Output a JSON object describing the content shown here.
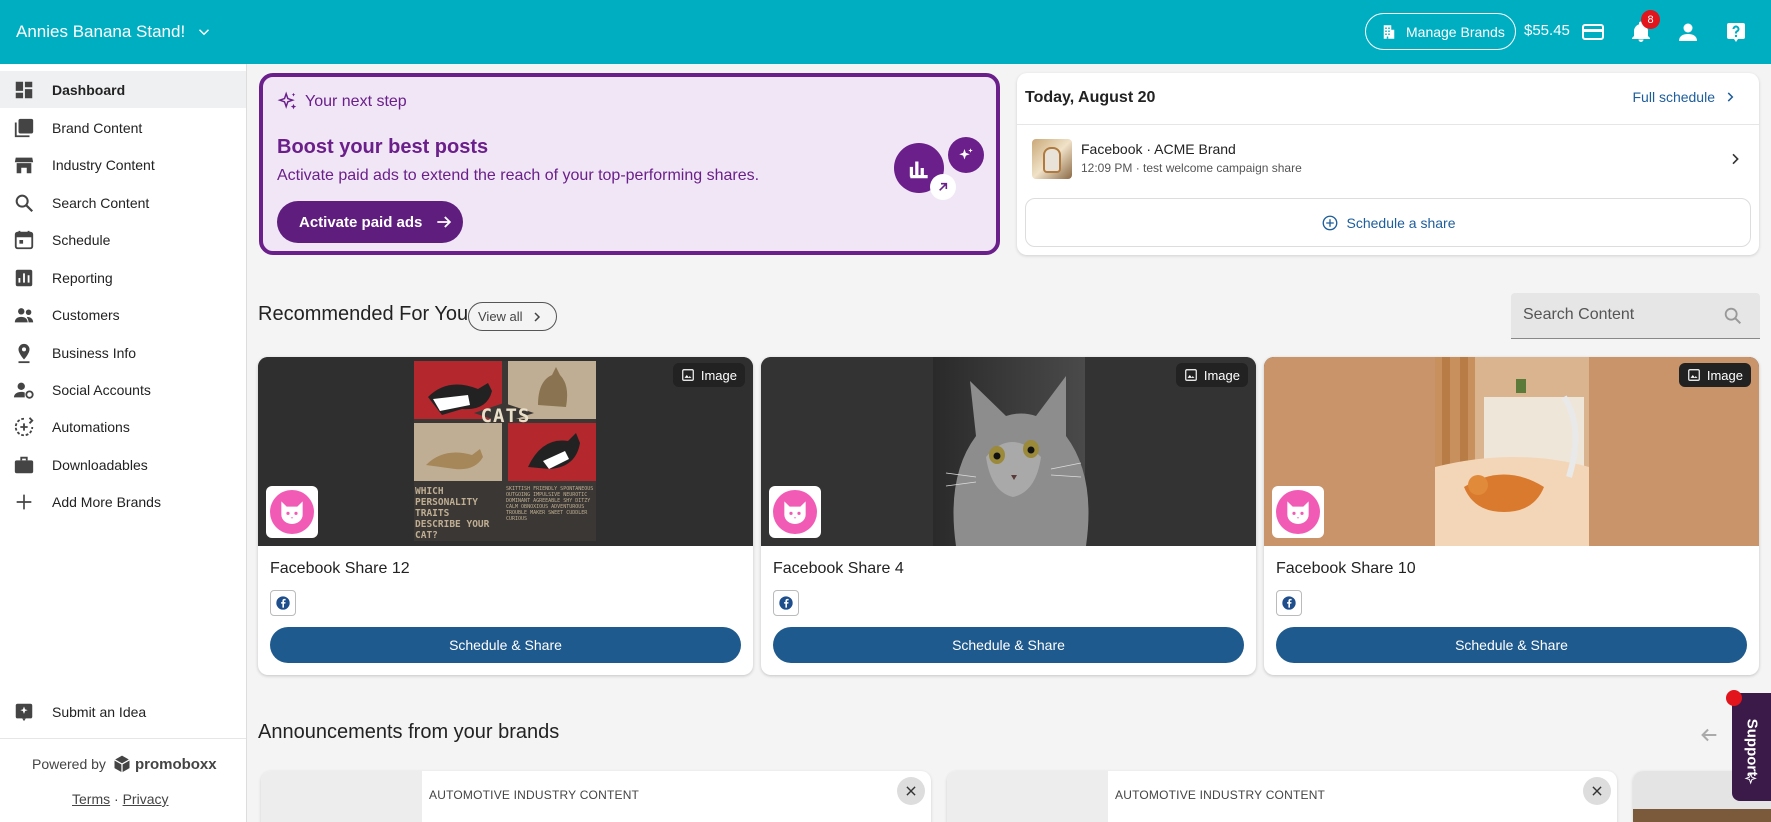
{
  "colors": {
    "topbar": "#00aec2",
    "accent_purple": "#6a1f8a",
    "primary_button": "#1f5a8e",
    "link_blue": "#1d5d9b",
    "badge_red": "#e2141c"
  },
  "header": {
    "brand_name": "Annies Banana Stand!",
    "manage_brands_label": "Manage Brands",
    "balance": "$55.45",
    "notification_count": "8",
    "icons": [
      "building-icon",
      "credit-card-icon",
      "bell-icon",
      "user-icon",
      "help-icon"
    ]
  },
  "sidebar": {
    "items": [
      {
        "label": "Dashboard",
        "icon": "dashboard-icon"
      },
      {
        "label": "Brand Content",
        "icon": "library-icon"
      },
      {
        "label": "Industry Content",
        "icon": "store-icon"
      },
      {
        "label": "Search Content",
        "icon": "search-icon"
      },
      {
        "label": "Schedule",
        "icon": "calendar-icon"
      },
      {
        "label": "Reporting",
        "icon": "bar-chart-icon"
      },
      {
        "label": "Customers",
        "icon": "people-icon"
      },
      {
        "label": "Business Info",
        "icon": "location-pin-icon"
      },
      {
        "label": "Social Accounts",
        "icon": "user-gear-icon"
      },
      {
        "label": "Automations",
        "icon": "automation-icon"
      },
      {
        "label": "Downloadables",
        "icon": "briefcase-icon"
      },
      {
        "label": "Add More Brands",
        "icon": "plus-icon"
      }
    ],
    "submit_idea": "Submit an Idea",
    "powered_by": "Powered by",
    "powered_brand": "promoboxx",
    "terms": "Terms",
    "separator": "·",
    "privacy": "Privacy"
  },
  "next_step": {
    "header": "Your next step",
    "title": "Boost your best posts",
    "description": "Activate paid ads to extend the reach of your top-performing shares.",
    "button_label": "Activate paid ads"
  },
  "today": {
    "title": "Today, August 20",
    "full_schedule": "Full schedule",
    "share": {
      "title": "Facebook · ACME Brand",
      "subtitle": "12:09 PM · test welcome campaign share"
    },
    "schedule_button": "Schedule a share"
  },
  "recommended": {
    "title": "Recommended For You",
    "view_all": "View all",
    "search_placeholder": "Search Content",
    "cards": [
      {
        "title": "Facebook Share 12",
        "badge": "Image",
        "button": "Schedule & Share",
        "poster_heading": "CATS",
        "poster_question": "WHICH PERSONALITY TRAITS DESCRIBE YOUR CAT?",
        "poster_traits": "SKITTISH FRIENDLY SPONTANEOUS OUTGOING IMPULSIVE NEUROTIC DOMINANT AGREEABLE SHY DITZY CALM OBNOXIOUS ADVENTUROUS TROUBLE MAKER SWEET CUDDLER CURIOUS"
      },
      {
        "title": "Facebook Share 4",
        "badge": "Image",
        "button": "Schedule & Share"
      },
      {
        "title": "Facebook Share 10",
        "badge": "Image",
        "button": "Schedule & Share"
      }
    ]
  },
  "announcements": {
    "title": "Announcements from your brands",
    "cards": [
      {
        "label": "AUTOMOTIVE INDUSTRY CONTENT"
      },
      {
        "label": "AUTOMOTIVE INDUSTRY CONTENT"
      }
    ]
  },
  "support": {
    "label": "Support"
  }
}
